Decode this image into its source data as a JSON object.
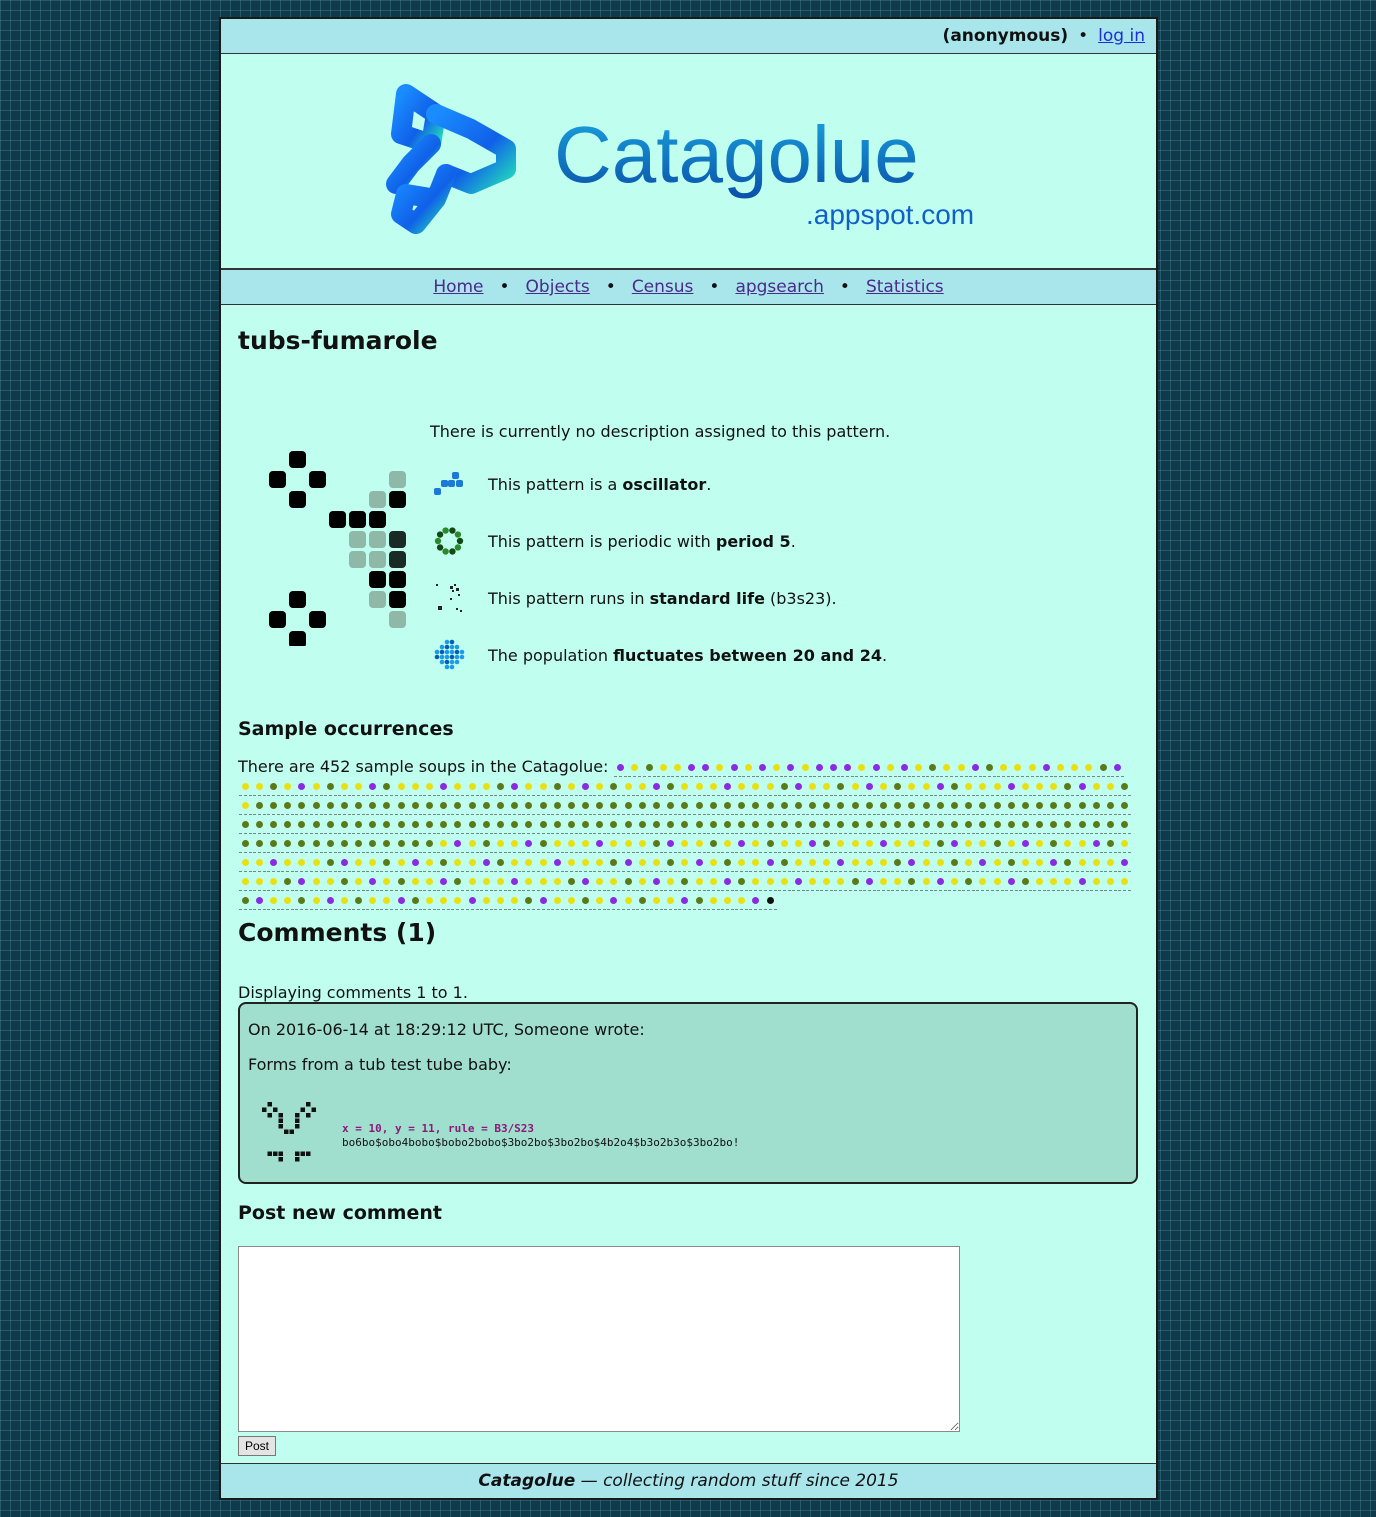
{
  "userbar": {
    "user": "(anonymous)",
    "sep": "•",
    "login": "log in"
  },
  "logo": {
    "title": "Catagolue",
    "subtitle": ".appspot.com"
  },
  "nav": [
    {
      "label": "Home"
    },
    {
      "label": "Objects"
    },
    {
      "label": "Census"
    },
    {
      "label": "apgsearch"
    },
    {
      "label": "Statistics"
    }
  ],
  "nav_sep": "•",
  "page_title": "tubs-fumarole",
  "description": "There is currently no description assigned to this pattern.",
  "properties": [
    {
      "icon": "glider-icon",
      "pre": "This pattern is a ",
      "bold": "oscillator",
      "post": "."
    },
    {
      "icon": "ring-icon",
      "pre": "This pattern is periodic with ",
      "bold": "period 5",
      "post": "."
    },
    {
      "icon": "rule-icon",
      "pre": "This pattern runs in ",
      "bold": "standard life",
      "post": " (b3s23)."
    },
    {
      "icon": "population-icon",
      "pre": "The population ",
      "bold": "fluctuates between 20 and 24",
      "post": "."
    }
  ],
  "samples": {
    "heading": "Sample occurrences",
    "intro": "There are 452 sample soups in the Catagolue:",
    "count": 452,
    "colors": {
      "yellow": "#e8e010",
      "purple": "#8a2be2",
      "olive": "#5a7a1a",
      "black": "#111111"
    }
  },
  "comments": {
    "heading": "Comments (1)",
    "displaying": "Displaying comments 1 to 1.",
    "items": [
      {
        "header": "On 2016-06-14 at 18:29:12 UTC, Someone wrote:",
        "body": "Forms from a tub test tube baby:",
        "rle_header": "x = 10, y = 11, rule = B3/S23",
        "rle": "bo6bo$obo4bobo$bobo2bobo$3bo2bo$3bo2bo$4b2o4$b3o2b3o$3bo2bo!"
      }
    ]
  },
  "post": {
    "heading": "Post new comment",
    "button": "Post",
    "value": ""
  },
  "footer": {
    "brand": "Catagolue",
    "text": " — collecting random stuff since 2015"
  }
}
